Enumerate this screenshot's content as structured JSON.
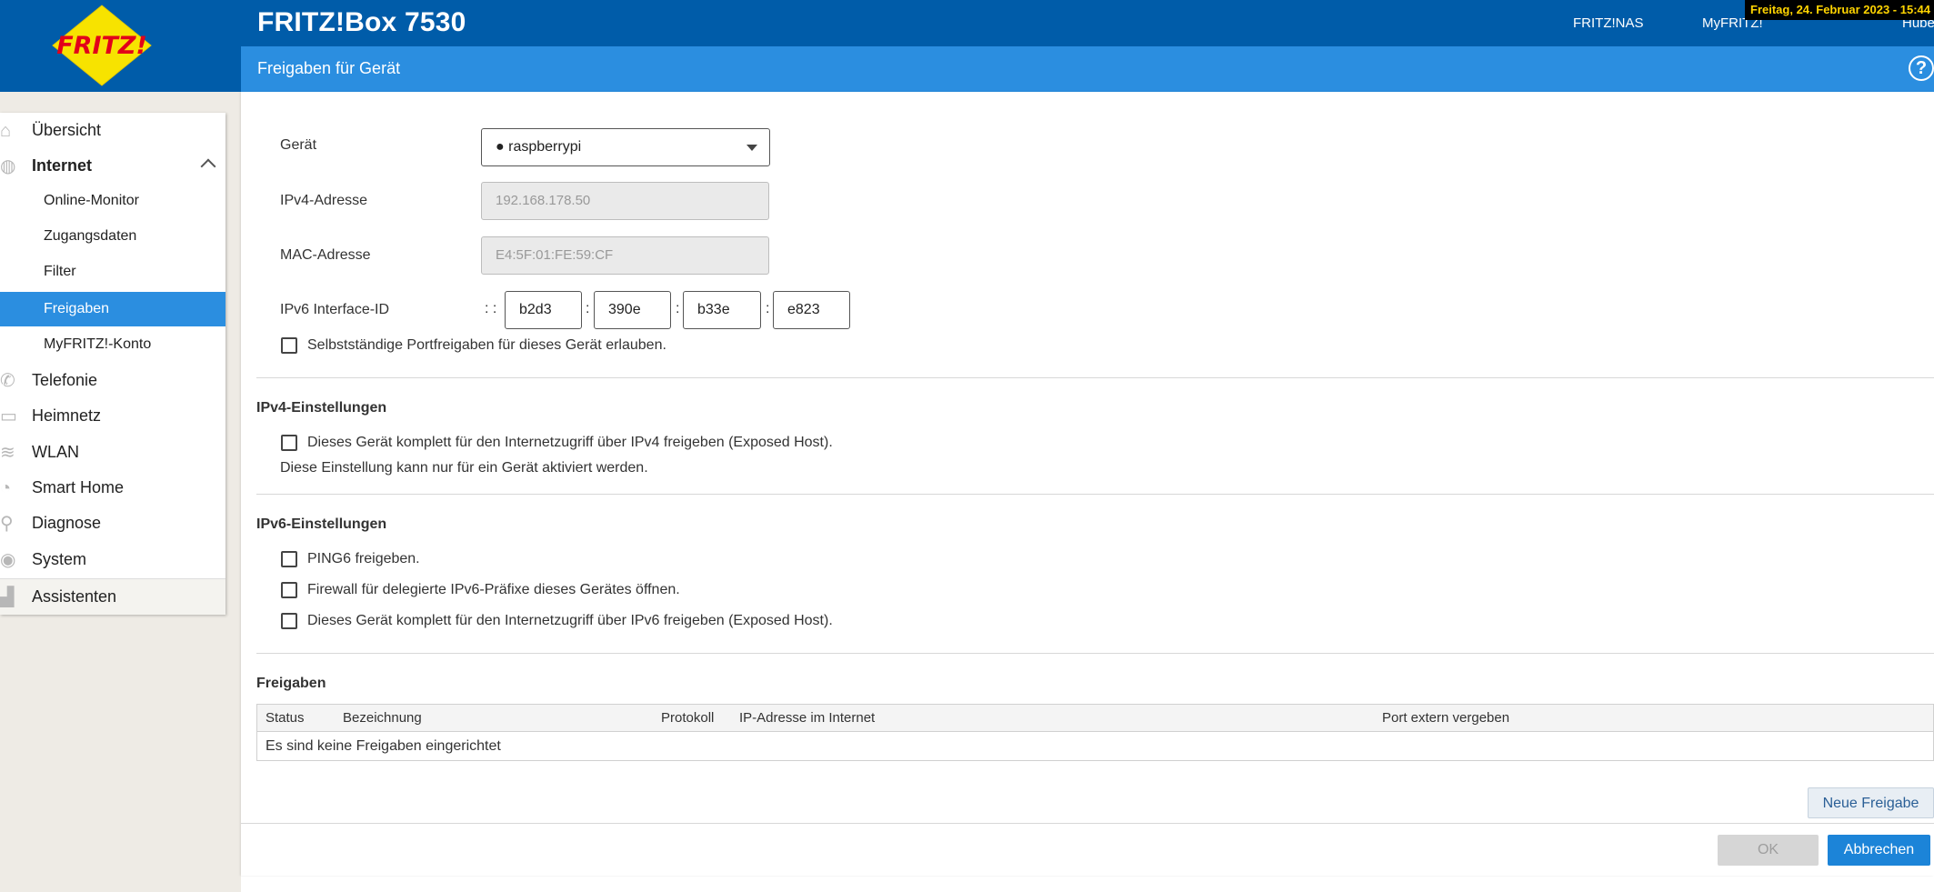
{
  "header": {
    "product_title": "FRITZ!Box 7530",
    "page_heading": "Freigaben für Gerät",
    "links": {
      "nas": "FRITZ!NAS",
      "myfritz": "MyFRITZ!",
      "user": "Huber"
    },
    "datetime": "Freitag, 24. Februar 2023 - 15:44",
    "help": "?",
    "logo_text": "FRITZ!"
  },
  "sidebar": {
    "items": [
      {
        "label": "Übersicht",
        "icon": "home-icon"
      },
      {
        "label": "Internet",
        "icon": "globe-icon"
      },
      {
        "label": "Online-Monitor"
      },
      {
        "label": "Zugangsdaten"
      },
      {
        "label": "Filter"
      },
      {
        "label": "Freigaben"
      },
      {
        "label": "MyFRITZ!-Konto"
      },
      {
        "label": "Telefonie",
        "icon": "phone-icon"
      },
      {
        "label": "Heimnetz",
        "icon": "network-icon"
      },
      {
        "label": "WLAN",
        "icon": "wifi-icon"
      },
      {
        "label": "Smart Home",
        "icon": "smarthome-icon"
      },
      {
        "label": "Diagnose",
        "icon": "diagnose-icon"
      },
      {
        "label": "System",
        "icon": "system-icon"
      },
      {
        "label": "Assistenten",
        "icon": "wizard-icon"
      }
    ]
  },
  "form": {
    "device_label": "Gerät",
    "device_value": "● raspberrypi",
    "ipv4_label": "IPv4-Adresse",
    "ipv4_value": "192.168.178.50",
    "mac_label": "MAC-Adresse",
    "mac_value": "E4:5F:01:FE:59:CF",
    "ipv6_label": "IPv6 Interface-ID",
    "ipv6_prefix": ": :",
    "ipv6_parts": [
      "b2d3",
      "390e",
      "b33e",
      "e823"
    ],
    "colon": ":",
    "self_port_label": "Selbstständige Portfreigaben für dieses Gerät erlauben."
  },
  "ipv4_settings": {
    "title": "IPv4-Einstellungen",
    "exposed_label": "Dieses Gerät komplett für den Internetzugriff über IPv4 freigeben (Exposed Host).",
    "note": "Diese Einstellung kann nur für ein Gerät aktiviert werden."
  },
  "ipv6_settings": {
    "title": "IPv6-Einstellungen",
    "ping6_label": "PING6 freigeben.",
    "firewall_label": "Firewall für delegierte IPv6-Präfixe dieses Gerätes öffnen.",
    "exposed_label": "Dieses Gerät komplett für den Internetzugriff über IPv6 freigeben (Exposed Host)."
  },
  "freigaben": {
    "title": "Freigaben",
    "columns": [
      "Status",
      "Bezeichnung",
      "Protokoll",
      "IP-Adresse im Internet",
      "Port extern vergeben"
    ],
    "empty_text": "Es sind keine Freigaben eingerichtet",
    "new_button": "Neue Freigabe"
  },
  "footer": {
    "ok_label": "OK",
    "cancel_label": "Abbrechen"
  },
  "colors": {
    "header": "#005ca9",
    "subheader": "#2b8ee0",
    "active_nav": "#2b8ee0",
    "primary_button": "#1c84d8"
  }
}
